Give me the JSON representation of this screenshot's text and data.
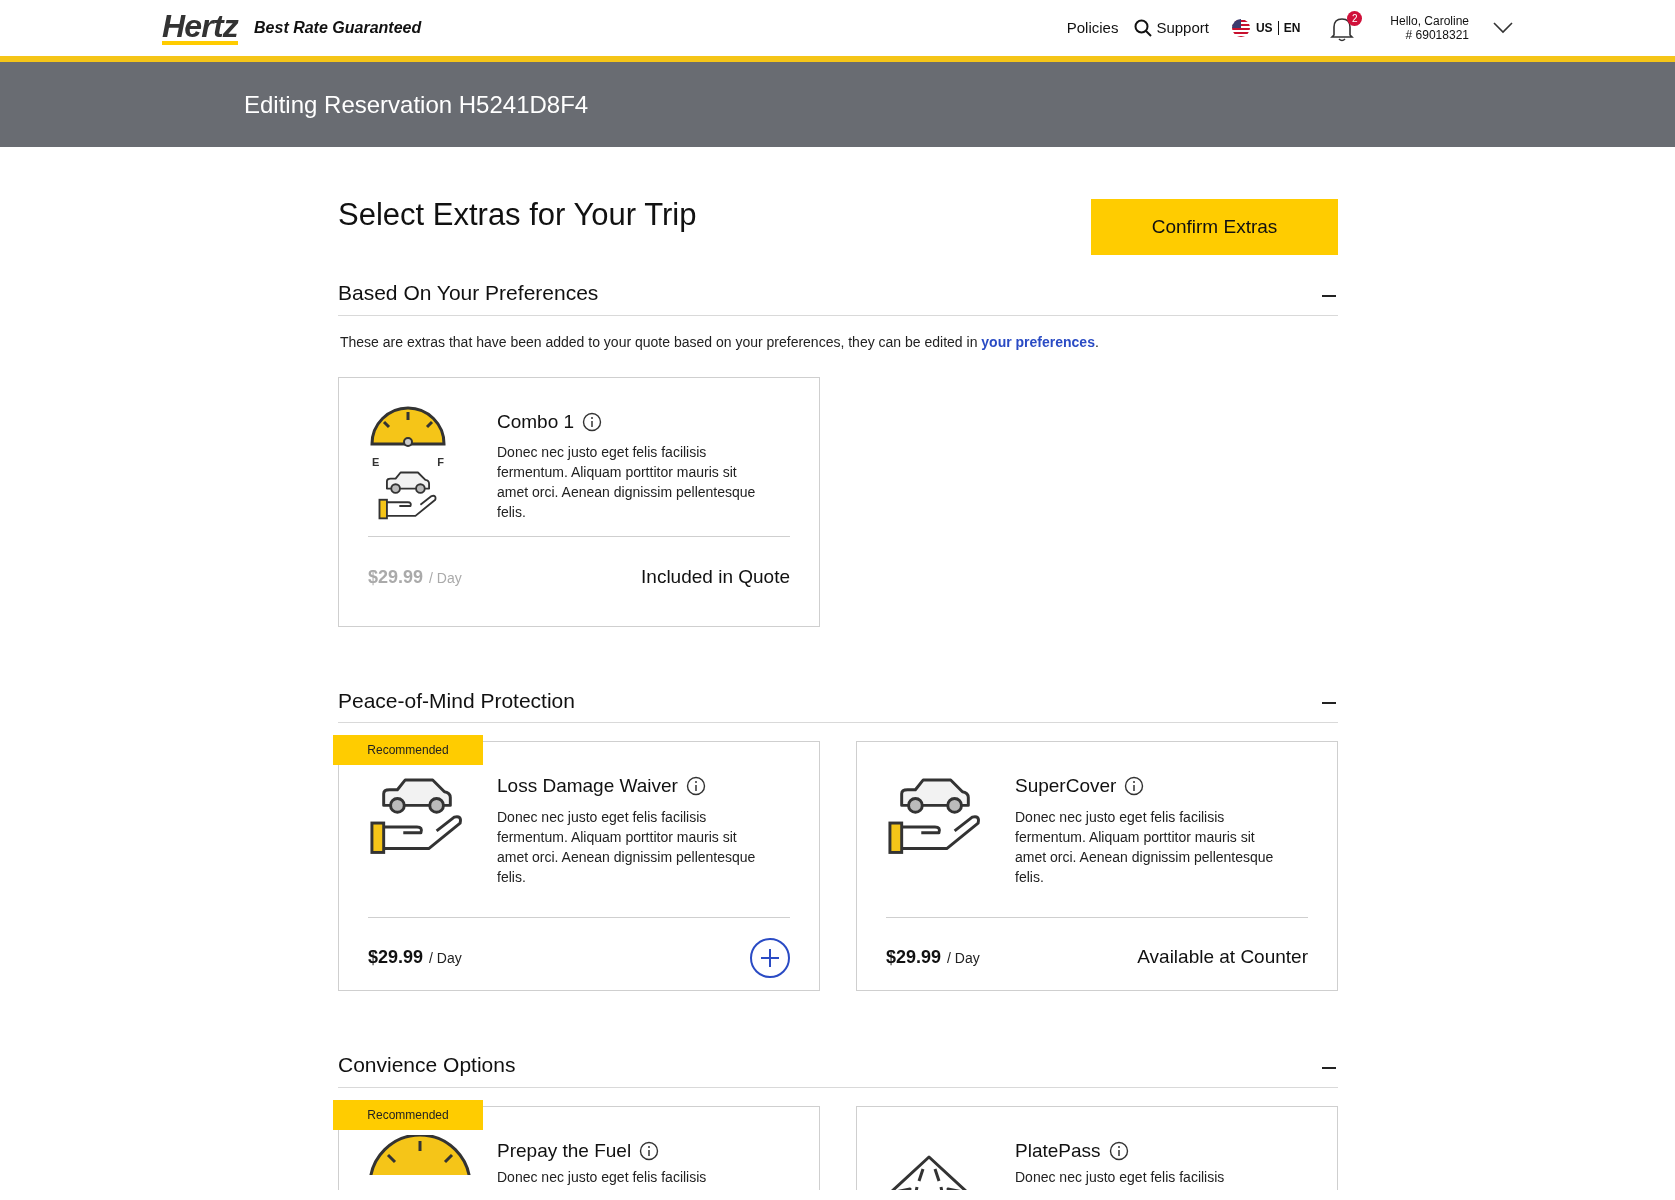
{
  "header": {
    "logo": "Hertz",
    "tagline": "Best Rate Guaranteed",
    "nav": [
      "Policies",
      "Support"
    ],
    "locale": {
      "country": "US",
      "language": "EN"
    },
    "notifications": "2",
    "greeting": "Hello, Caroline",
    "member_number": "# 69018321"
  },
  "banner": {
    "title": "Editing Reservation H5241D8F4"
  },
  "page": {
    "title": "Select Extras for Your Trip",
    "confirm_button": "Confirm Extras"
  },
  "sections": [
    {
      "title": "Based On Your Preferences",
      "expanded": true,
      "description": {
        "text": "These are extras that have been added to your quote based on your preferences, they can be edited in ",
        "link": "your preferences",
        "after": "."
      },
      "cards": [
        {
          "kind": "fuel-car",
          "recommended": false,
          "title": "Combo 1",
          "description": "Donec nec justo eget felis facilisis fermentum. Aliquam porttitor mauris sit amet orci. Aenean dignissim pellentesque felis.",
          "gauge_labels": [
            "E",
            "F"
          ],
          "price": "$29.99",
          "unit": "/ Day",
          "muted": true,
          "action": {
            "kind": "status",
            "text": "Included in Quote"
          }
        }
      ]
    },
    {
      "title": "Peace-of-Mind Protection",
      "expanded": true,
      "cards": [
        {
          "kind": "car-hand",
          "recommended": true,
          "badge": "Recommended",
          "title": "Loss Damage Waiver",
          "description": "Donec nec justo eget felis facilisis fermentum. Aliquam porttitor mauris sit amet orci. Aenean dignissim pellentesque felis.",
          "price": "$29.99",
          "unit": "/ Day",
          "muted": false,
          "action": {
            "kind": "add"
          }
        },
        {
          "kind": "car-hand",
          "recommended": false,
          "title": "SuperCover",
          "description": "Donec nec justo eget felis facilisis fermentum. Aliquam porttitor mauris sit amet orci. Aenean dignissim pellentesque felis.",
          "price": "$29.99",
          "unit": "/ Day",
          "muted": false,
          "action": {
            "kind": "status",
            "text": "Available at Counter"
          }
        }
      ]
    },
    {
      "title": "Convience Options",
      "expanded": true,
      "cards": [
        {
          "kind": "fuel",
          "recommended": true,
          "badge": "Recommended",
          "title": "Prepay the Fuel",
          "description": "Donec nec justo eget felis facilisis"
        },
        {
          "kind": "road",
          "recommended": false,
          "title": "PlatePass",
          "description": "Donec nec justo eget felis facilisis"
        }
      ]
    }
  ]
}
